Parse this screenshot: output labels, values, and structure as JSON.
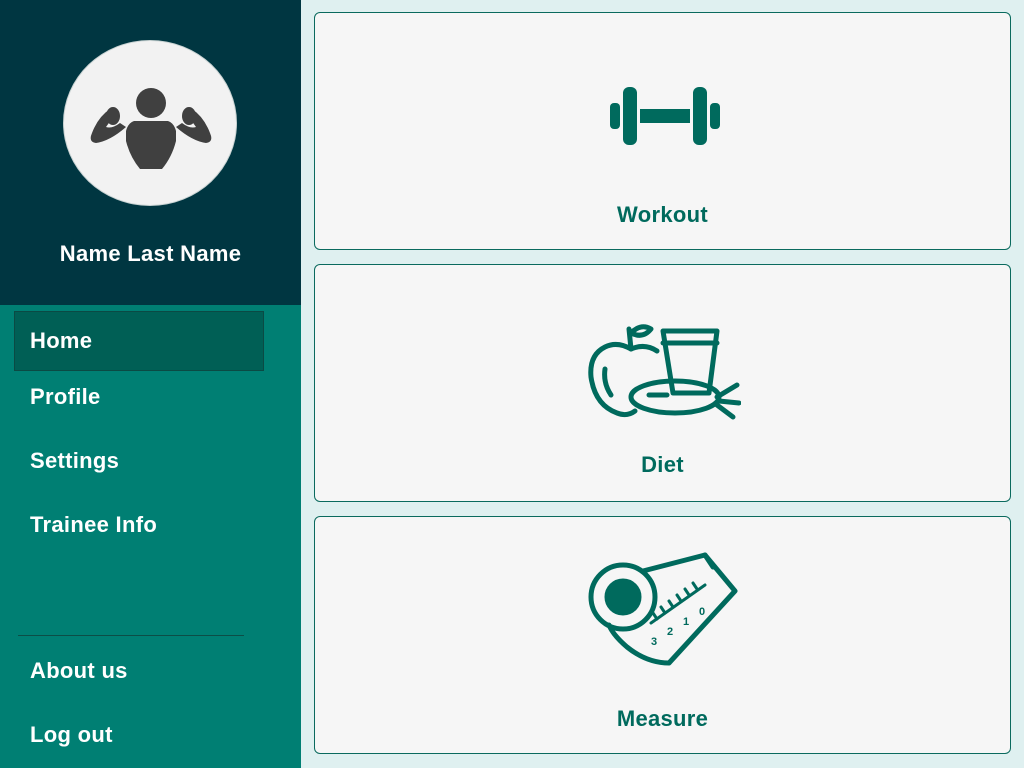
{
  "sidebar": {
    "user_name": "Name Last Name",
    "avatar_icon": "bodybuilder-icon",
    "nav": [
      {
        "label": "Home",
        "active": true
      },
      {
        "label": "Profile",
        "active": false
      },
      {
        "label": "Settings",
        "active": false
      },
      {
        "label": "Trainee Info",
        "active": false
      }
    ],
    "footer_nav": [
      {
        "label": "About us"
      },
      {
        "label": "Log out"
      }
    ]
  },
  "cards": [
    {
      "label": "Workout",
      "icon": "dumbbell-icon"
    },
    {
      "label": "Diet",
      "icon": "food-icon"
    },
    {
      "label": "Measure",
      "icon": "measuring-tape-icon"
    }
  ],
  "colors": {
    "sidebar_bg": "#007f73",
    "profile_bg": "#003641",
    "active_item_bg": "#005f55",
    "card_bg": "#f6f6f6",
    "accent": "#006a5d",
    "page_bg": "#dff0f0"
  },
  "measure_icon_numbers": [
    "3",
    "2",
    "1",
    "0"
  ]
}
